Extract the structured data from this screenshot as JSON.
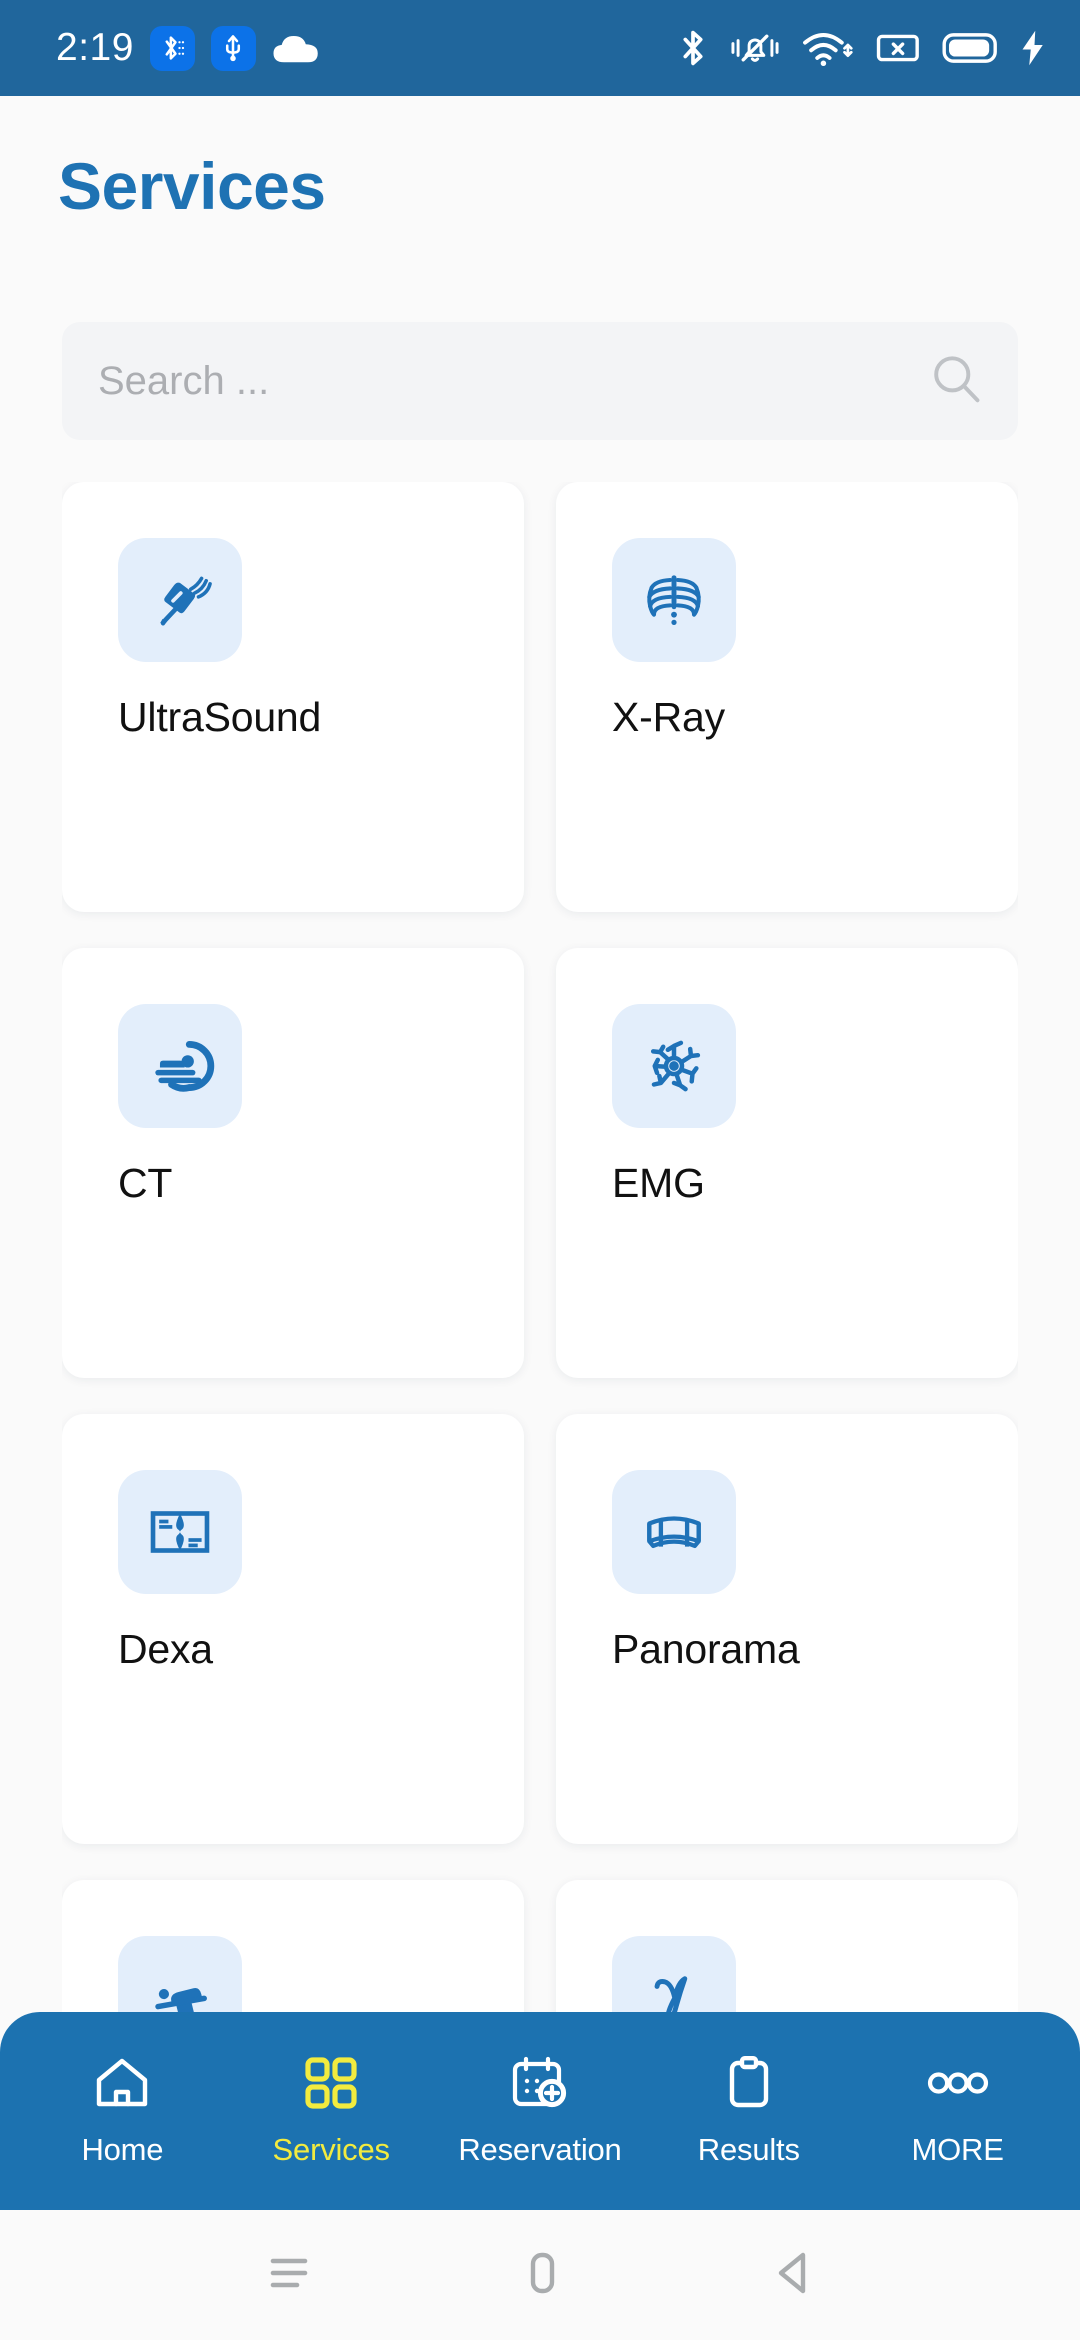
{
  "status_bar": {
    "clock": "2:19",
    "bg_color": "#20669C",
    "left_icons": [
      {
        "name": "bluetooth-share-badge-icon",
        "glyph": "bluetooth"
      },
      {
        "name": "usb-badge-icon",
        "glyph": "usb"
      },
      {
        "name": "cloud-icon",
        "glyph": "cloud"
      }
    ],
    "right_icons": [
      {
        "name": "bluetooth-icon",
        "glyph": "bluetooth"
      },
      {
        "name": "vibrate-mute-icon",
        "glyph": "bell-slash"
      },
      {
        "name": "wifi-icon",
        "glyph": "wifi"
      },
      {
        "name": "sim-card-icon",
        "glyph": "sim"
      },
      {
        "name": "battery-icon",
        "glyph": "battery"
      },
      {
        "name": "charging-bolt-icon",
        "glyph": "bolt"
      }
    ]
  },
  "header": {
    "title": "Services",
    "title_color": "#1E72B3"
  },
  "search": {
    "placeholder": "Search ...",
    "value": "",
    "icon": "search-icon"
  },
  "services": [
    {
      "label": "UltraSound",
      "icon": "ultrasound-probe-icon"
    },
    {
      "label": "X-Ray",
      "icon": "rib-cage-icon"
    },
    {
      "label": "CT",
      "icon": "ct-scanner-icon"
    },
    {
      "label": "EMG",
      "icon": "neuron-icon"
    },
    {
      "label": "Dexa",
      "icon": "bone-density-scan-icon"
    },
    {
      "label": "Panorama",
      "icon": "panoramic-band-icon"
    },
    {
      "label": "",
      "icon": "patient-table-icon"
    },
    {
      "label": "",
      "icon": "gamma-symbol-icon"
    }
  ],
  "bottom_nav": {
    "bg_color": "#1C72B0",
    "active_color": "#F2EB3F",
    "items": [
      {
        "label": "Home",
        "icon": "home-icon",
        "active": false
      },
      {
        "label": "Services",
        "icon": "grid-icon",
        "active": true
      },
      {
        "label": "Reservation",
        "icon": "calendar-plus-icon",
        "active": false
      },
      {
        "label": "Results",
        "icon": "clipboard-icon",
        "active": false
      },
      {
        "label": "MORE",
        "icon": "three-dots-icon",
        "active": false
      }
    ]
  },
  "android_nav": {
    "items": [
      {
        "name": "recents-button",
        "icon": "hamburger-icon"
      },
      {
        "name": "home-button",
        "icon": "rounded-rect-icon"
      },
      {
        "name": "back-button",
        "icon": "triangle-left-icon"
      }
    ]
  }
}
